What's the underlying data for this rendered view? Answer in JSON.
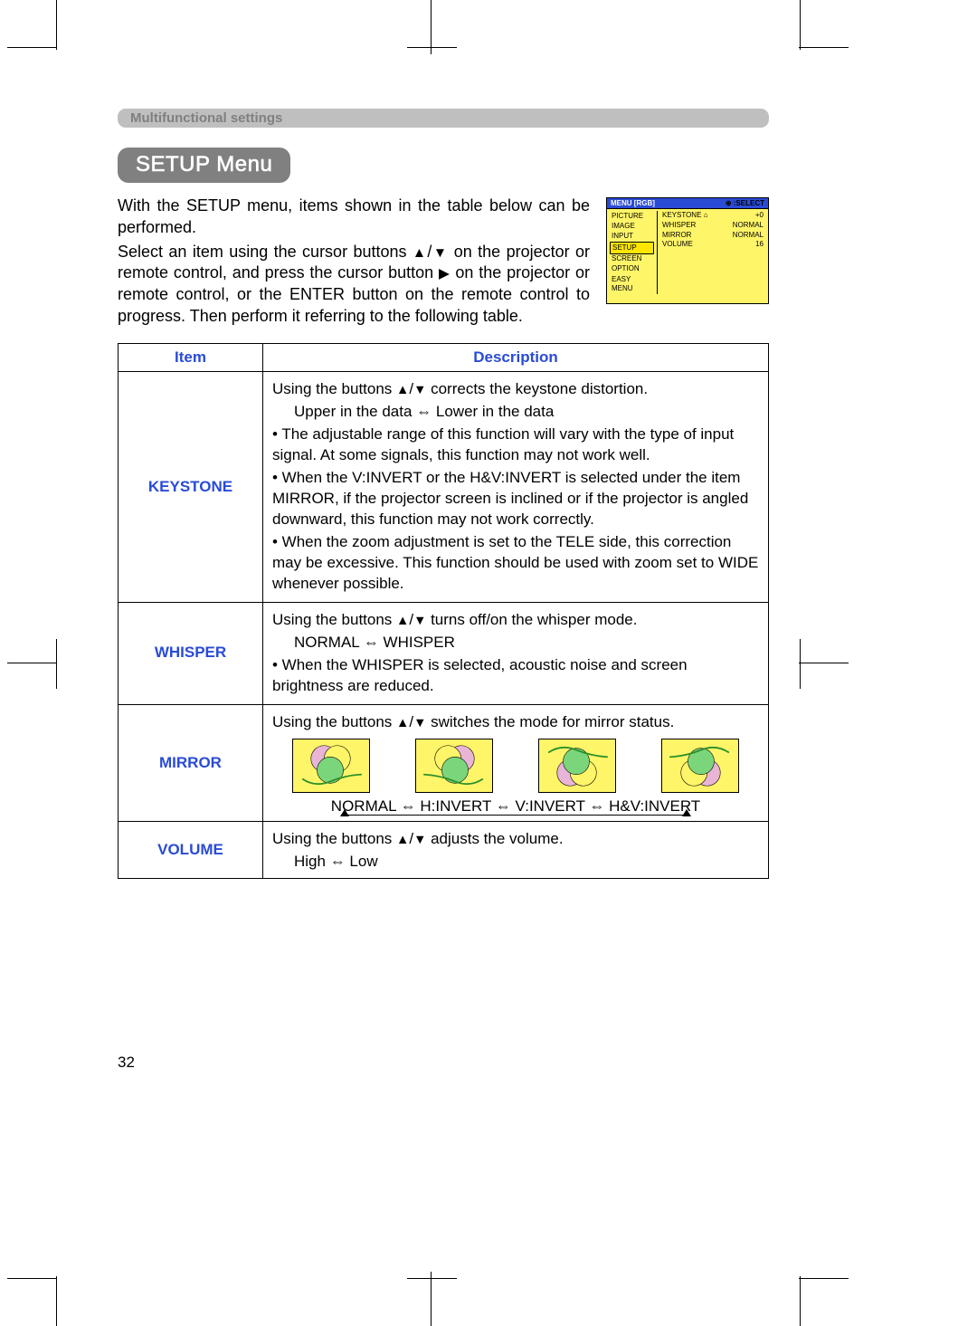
{
  "section_label": "Multifunctional settings",
  "page_title": "SETUP Menu",
  "intro_paragraph_1": "With the SETUP menu, items shown in the table below can be performed.",
  "intro_paragraph_2_pre": "Select an item using the cursor buttons ",
  "intro_paragraph_2_post": " on the projector or remote control, and press the cursor button ",
  "intro_paragraph_2_tail": " on the projector or remote control, or the ENTER button on the remote control to progress. Then perform it referring to the following table.",
  "osd": {
    "title_left": "MENU [RGB]",
    "title_right": ":SELECT",
    "left_items": [
      "PICTURE",
      "IMAGE",
      "INPUT",
      "SETUP",
      "SCREEN",
      "OPTION",
      "EASY MENU"
    ],
    "left_selected_index": 3,
    "right_rows": [
      {
        "k": "KEYSTONE",
        "v": "+0",
        "icon": "keystone"
      },
      {
        "k": "WHISPER",
        "v": "NORMAL"
      },
      {
        "k": "MIRROR",
        "v": "NORMAL"
      },
      {
        "k": "VOLUME",
        "v": "16"
      }
    ]
  },
  "table": {
    "head_item": "Item",
    "head_desc": "Description",
    "rows": [
      {
        "item": "KEYSTONE",
        "lines": {
          "l1_pre": "Using the buttons ",
          "l1_post": " corrects the keystone distortion.",
          "l2_pre": "Upper in the data ",
          "l2_post": " Lower in the data",
          "b1": "• The adjustable range of this function will vary with the type of input signal. At some signals, this function may not work well.",
          "b2": "• When the V:INVERT or the H&V:INVERT is selected under the item MIRROR, if the projector screen is inclined or if the projector is angled downward, this function may not work correctly.",
          "b3": "• When the zoom adjustment is set to the TELE side, this correction may be excessive. This function should be used with zoom set to WIDE whenever possible."
        }
      },
      {
        "item": "WHISPER",
        "lines": {
          "l1_pre": "Using the buttons ",
          "l1_post": " turns off/on the whisper mode.",
          "l2_pre": "NORMAL ",
          "l2_post": " WHISPER",
          "b1": "• When the WHISPER is selected, acoustic noise and screen brightness are reduced."
        }
      },
      {
        "item": "MIRROR",
        "lines": {
          "l1_pre": "Using the buttons ",
          "l1_post": " switches the mode for mirror status.",
          "modes": "NORMAL ⇔ H:INVERT ⇔ V:INVERT ⇔ H&V:INVERT"
        }
      },
      {
        "item": "VOLUME",
        "lines": {
          "l1_pre": "Using the buttons ",
          "l1_post": " adjusts the volume.",
          "l2_pre": "High ",
          "l2_post": " Low"
        }
      }
    ]
  },
  "page_number": "32"
}
